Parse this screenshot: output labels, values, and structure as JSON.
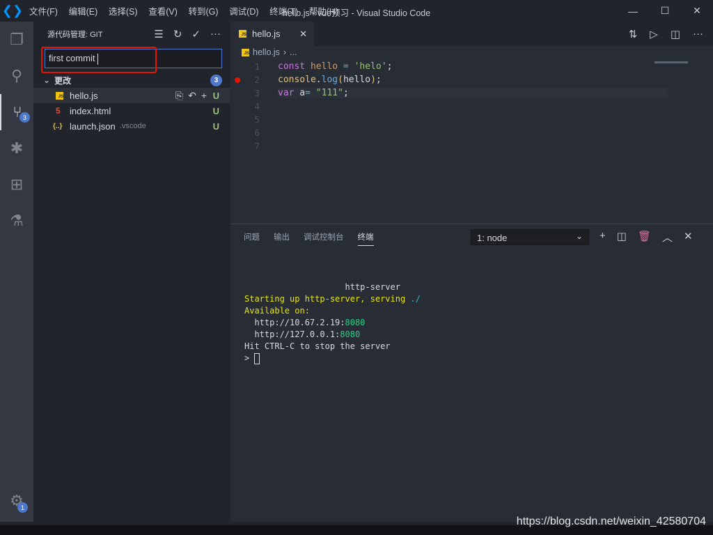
{
  "titlebar": {
    "menu": [
      "文件(F)",
      "编辑(E)",
      "选择(S)",
      "查看(V)",
      "转到(G)",
      "调试(D)",
      "终端(T)",
      "帮助(H)"
    ],
    "title": "hello.js - vue预习 - Visual Studio Code"
  },
  "activity": {
    "scm_badge": "3",
    "settings_badge": "1"
  },
  "sidebar": {
    "title": "源代码管理: GIT",
    "commit_message": "first commit",
    "group": "更改",
    "group_count": "3",
    "files": [
      {
        "name": "hello.js",
        "dir": "",
        "status": "U",
        "icon": "js-icon"
      },
      {
        "name": "index.html",
        "dir": "",
        "status": "U",
        "icon": "html5-icon"
      },
      {
        "name": "launch.json",
        "dir": ".vscode",
        "status": "U",
        "icon": "json-icon"
      }
    ]
  },
  "editor": {
    "tab": "hello.js",
    "breadcrumb": "hello.js",
    "breadcrumb_more": "...",
    "line_numbers": [
      "1",
      "2",
      "3",
      "4",
      "5",
      "6",
      "7"
    ],
    "code": {
      "l1": [
        "const",
        " hello",
        " =",
        " 'helo'",
        ";"
      ],
      "l2": [
        "console",
        ".",
        "log",
        "(",
        "hello",
        ")",
        ";"
      ],
      "l3": [
        "var",
        " a",
        "=",
        " \"111\"",
        ";"
      ]
    }
  },
  "panel": {
    "tabs": [
      "问题",
      "输出",
      "调试控制台",
      "终端"
    ],
    "active_tab": "终端",
    "terminal_select": "1: node",
    "terminal": {
      "l1": "                    http-server",
      "l2a": "Starting up http-server, serving ",
      "l2b": "./",
      "l3": "Available on:",
      "l4a": "  http://10.67.2.19:",
      "l4b": "8080",
      "l5a": "  http://127.0.0.1:",
      "l5b": "8080",
      "l6": "Hit CTRL-C to stop the server",
      "prompt": "> "
    }
  },
  "watermark": "https://blog.csdn.net/weixin_42580704",
  "colors": {
    "accent": "#4d78cc",
    "highlight_box": "#e51400",
    "untracked": "#98c379"
  }
}
